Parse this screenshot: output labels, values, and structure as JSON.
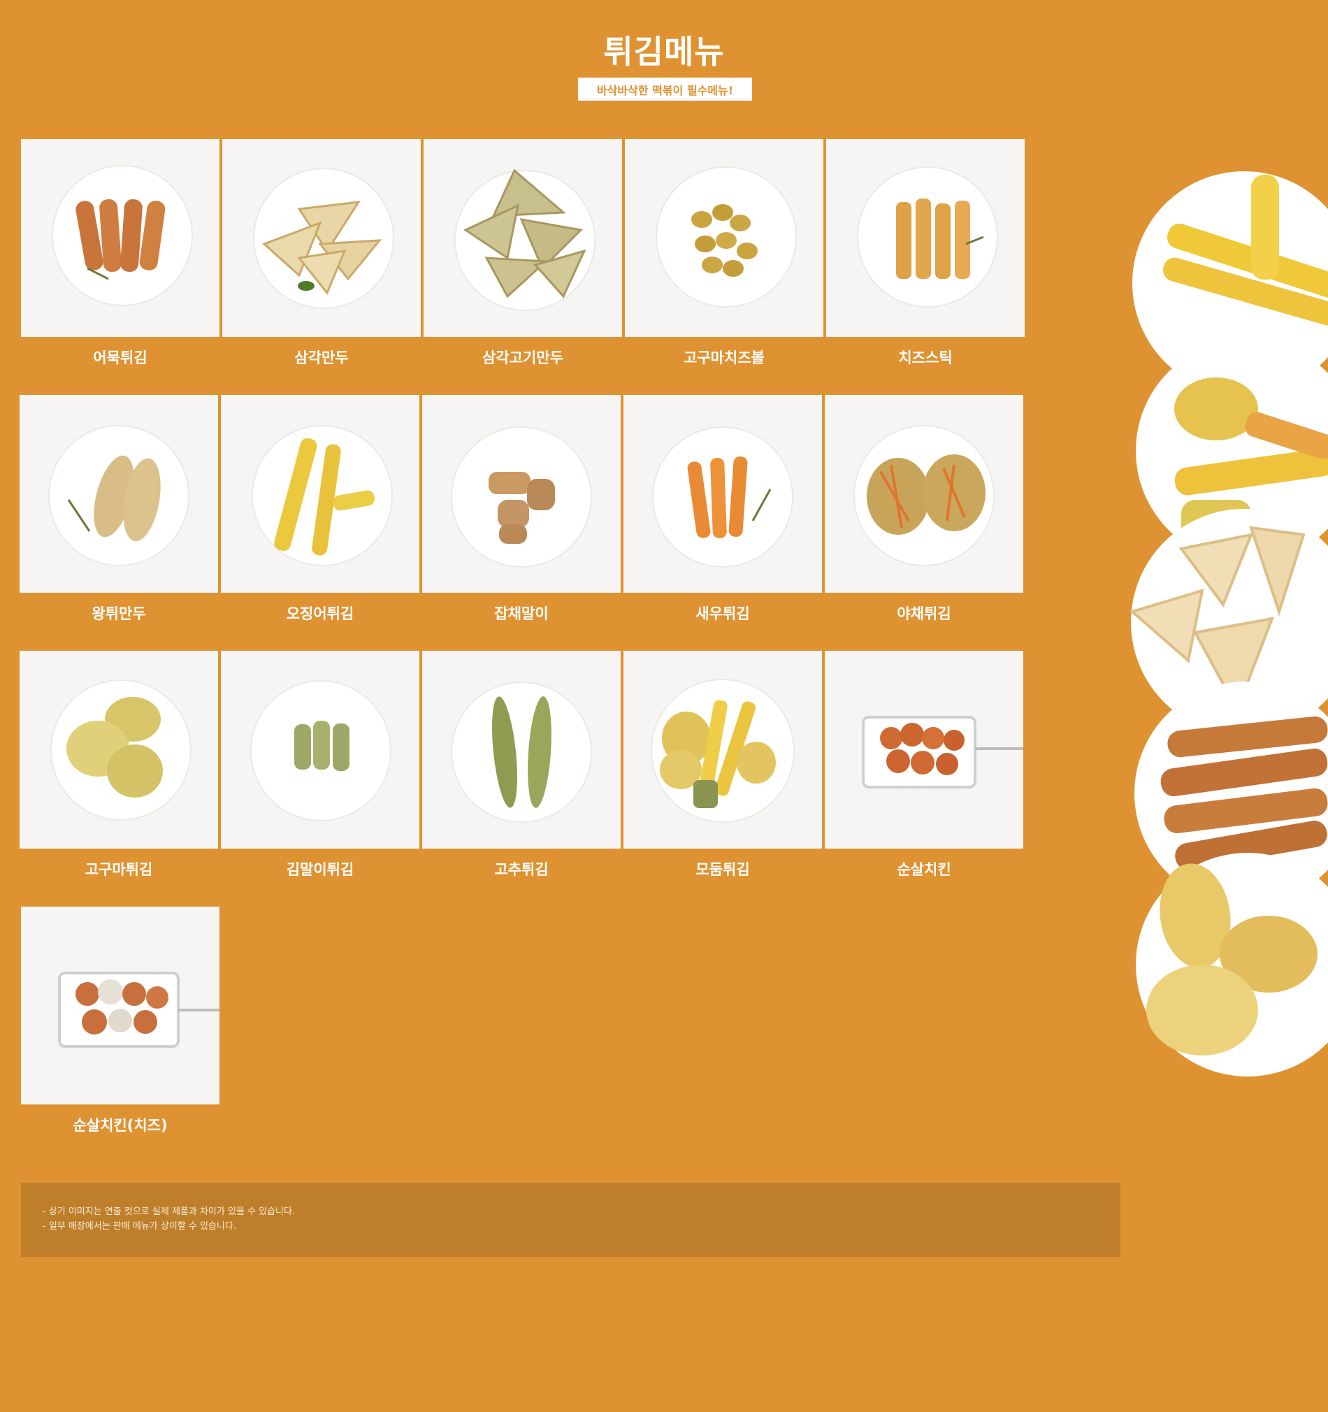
{
  "header": {
    "title": "튀김메뉴",
    "subtitle": "바삭바삭한 떡볶이 필수메뉴!"
  },
  "colors": {
    "background": "#df9231",
    "notice_background": "#bf7f2a",
    "card_background": "#f6f5f3",
    "text_light": "#ffffff"
  },
  "menu": [
    {
      "name": "어묵튀김",
      "icon": "fish-cake-fritter-photo"
    },
    {
      "name": "삼각만두",
      "icon": "triangle-dumpling-photo"
    },
    {
      "name": "삼각고기만두",
      "icon": "triangle-meat-dumpling-photo"
    },
    {
      "name": "고구마치즈볼",
      "icon": "sweet-potato-cheese-ball-photo"
    },
    {
      "name": "치즈스틱",
      "icon": "cheese-stick-photo"
    },
    {
      "name": "왕튀만두",
      "icon": "large-fried-dumpling-photo"
    },
    {
      "name": "오징어튀김",
      "icon": "squid-fritter-photo"
    },
    {
      "name": "잡채말이",
      "icon": "japchae-roll-photo"
    },
    {
      "name": "새우튀김",
      "icon": "shrimp-fritter-photo"
    },
    {
      "name": "야채튀김",
      "icon": "vegetable-fritter-photo"
    },
    {
      "name": "고구마튀김",
      "icon": "sweet-potato-fritter-photo"
    },
    {
      "name": "김말이튀김",
      "icon": "seaweed-roll-fritter-photo"
    },
    {
      "name": "고추튀김",
      "icon": "pepper-fritter-photo"
    },
    {
      "name": "모둠튀김",
      "icon": "assorted-fritter-photo"
    },
    {
      "name": "순살치킨",
      "icon": "boneless-chicken-photo"
    },
    {
      "name": "순살치킨(치즈)",
      "icon": "boneless-chicken-cheese-photo"
    }
  ],
  "notice": {
    "line1": "- 상기 이미지는 연출 컷으로 실제 제품과 차이가 있을 수 있습니다.",
    "line2": "- 일부 매장에서는 판매 메뉴가 상이할 수 있습니다."
  }
}
